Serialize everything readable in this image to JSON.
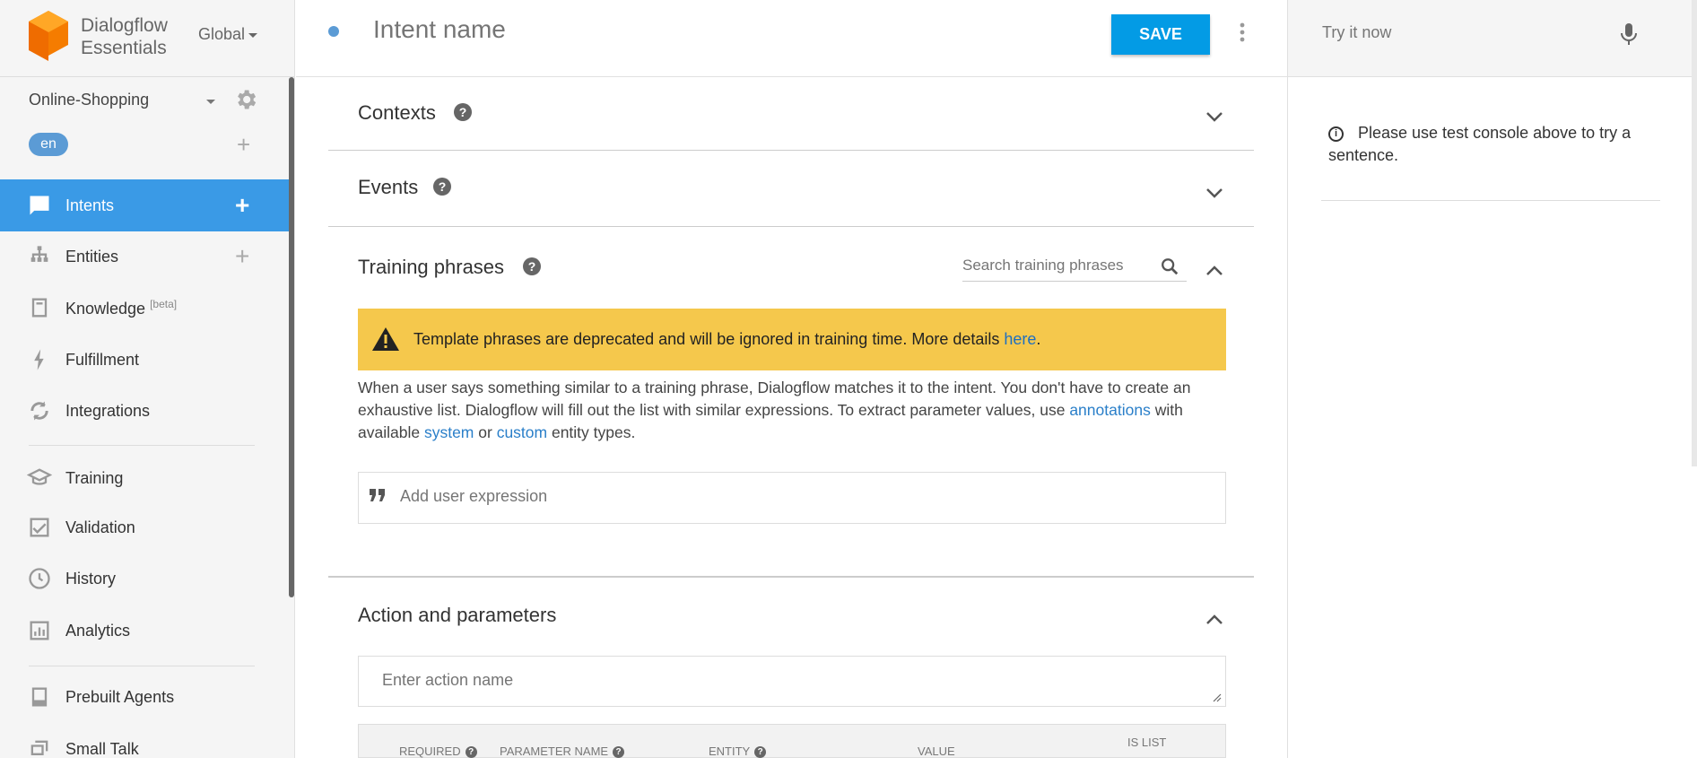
{
  "brand": {
    "line1": "Dialogflow",
    "line2": "Essentials",
    "region": "Global"
  },
  "agent": {
    "name": "Online-Shopping",
    "language": "en"
  },
  "nav": {
    "intents": "Intents",
    "entities": "Entities",
    "knowledge": "Knowledge",
    "knowledge_badge": "[beta]",
    "fulfillment": "Fulfillment",
    "integrations": "Integrations",
    "training": "Training",
    "validation": "Validation",
    "history": "History",
    "analytics": "Analytics",
    "prebuilt_agents": "Prebuilt Agents",
    "small_talk": "Small Talk"
  },
  "header": {
    "intent_placeholder": "Intent name",
    "save_label": "SAVE"
  },
  "sections": {
    "contexts": "Contexts",
    "events": "Events",
    "training_phrases": "Training phrases",
    "action_parameters": "Action and parameters"
  },
  "help_glyph": "?",
  "training": {
    "search_placeholder": "Search training phrases",
    "warning_text": "Template phrases are deprecated and will be ignored in training time. More details ",
    "warning_link": "here",
    "warning_end": ".",
    "desc_part1": "When a user says something similar to a training phrase, Dialogflow matches it to the intent. You don't have to create an exhaustive list. Dialogflow will fill out the list with similar expressions. To extract parameter values, use ",
    "desc_link1": "annotations",
    "desc_part2": " with available ",
    "desc_link2": "system",
    "desc_part3": " or ",
    "desc_link3": "custom",
    "desc_part4": " entity types.",
    "add_expression_placeholder": "Add user expression"
  },
  "action": {
    "action_placeholder": "Enter action name",
    "columns": {
      "required": "REQUIRED",
      "parameter_name": "PARAMETER NAME",
      "entity": "ENTITY",
      "value": "VALUE",
      "is_list": "IS LIST"
    }
  },
  "try_panel": {
    "placeholder": "Try it now",
    "info_glyph": "i",
    "message": "Please use test console above to try a sentence."
  },
  "colors": {
    "accent": "#3a9ae6",
    "save": "#039be5",
    "warning": "#f5c84c",
    "logo": "#f57c00",
    "link": "#2a7fc9"
  },
  "icons": [
    "logo-icon",
    "gear-icon",
    "chat-icon",
    "hierarchy-icon",
    "book-icon",
    "bolt-icon",
    "sync-icon",
    "cap-icon",
    "check-icon",
    "clock-icon",
    "chart-icon",
    "prebuilt-icon",
    "smalltalk-icon",
    "kebab-icon",
    "chevron-down-icon",
    "chevron-up-icon",
    "search-icon",
    "warning-icon",
    "quote-icon",
    "mic-icon",
    "info-icon"
  ]
}
